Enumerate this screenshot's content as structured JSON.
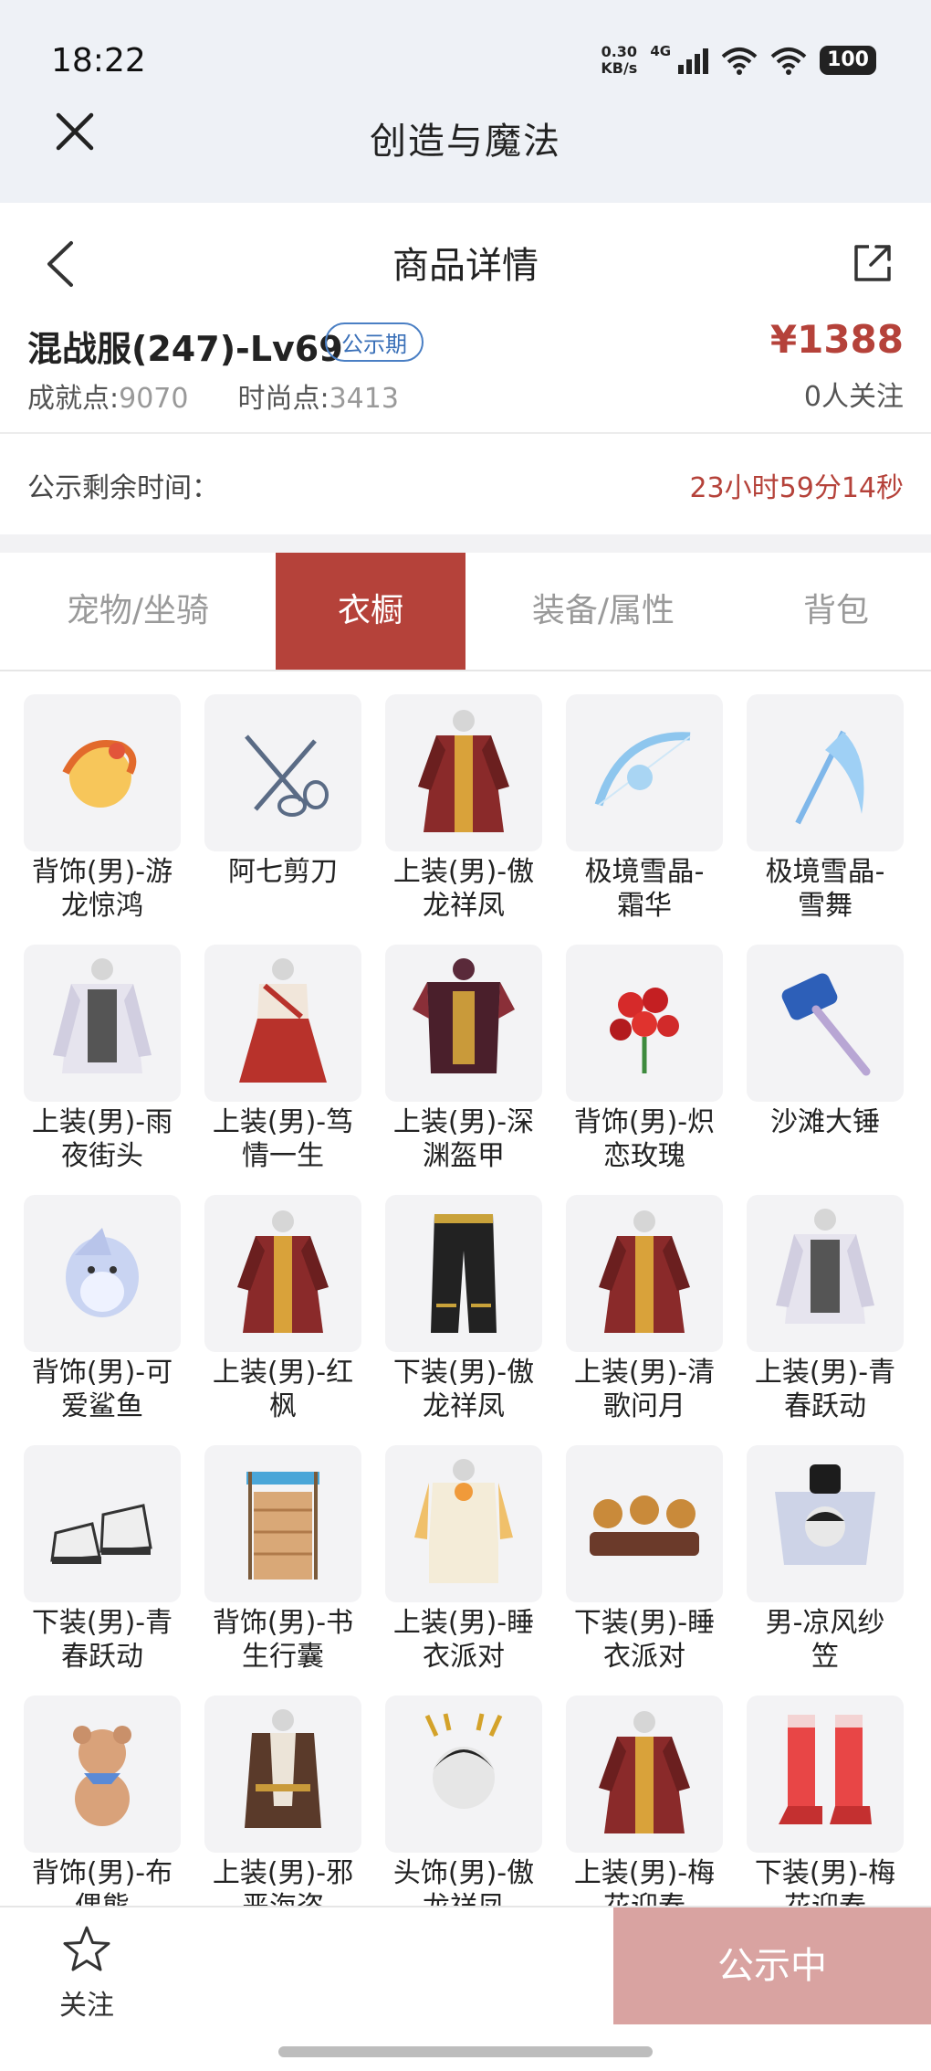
{
  "status_bar": {
    "time": "18:22",
    "speed_top": "0.30",
    "speed_bottom": "KB/s",
    "network": "4G",
    "battery": "100"
  },
  "app": {
    "title": "创造与魔法"
  },
  "nav": {
    "title": "商品详情"
  },
  "product": {
    "name": "混战服(247)-Lv69",
    "badge": "公示期",
    "price": "¥1388",
    "achievement_label": "成就点:",
    "achievement_value": "9070",
    "fashion_label": "时尚点:",
    "fashion_value": "3413",
    "followers": "0人关注"
  },
  "remaining": {
    "label": "公示剩余时间：",
    "value": "23小时59分14秒"
  },
  "tabs": [
    {
      "label": "宠物/坐骑",
      "active": false
    },
    {
      "label": "衣橱",
      "active": true
    },
    {
      "label": "装备/属性",
      "active": false
    },
    {
      "label": "背包",
      "active": false
    }
  ],
  "items": [
    {
      "line1": "背饰(男)-游",
      "line2": "龙惊鸿",
      "icon": "dragon-icon"
    },
    {
      "line1": "阿七剪刀",
      "line2": "",
      "icon": "scissors-icon"
    },
    {
      "line1": "上装(男)-傲",
      "line2": "龙祥凤",
      "icon": "robe-icon"
    },
    {
      "line1": "极境雪晶-",
      "line2": "霜华",
      "icon": "bow-icon"
    },
    {
      "line1": "极境雪晶-",
      "line2": "雪舞",
      "icon": "scythe-icon"
    },
    {
      "line1": "上装(男)-雨",
      "line2": "夜街头",
      "icon": "jacket-icon"
    },
    {
      "line1": "上装(男)-笃",
      "line2": "情一生",
      "icon": "dress-icon"
    },
    {
      "line1": "上装(男)-深",
      "line2": "渊盔甲",
      "icon": "armor-icon"
    },
    {
      "line1": "背饰(男)-炽",
      "line2": "恋玫瑰",
      "icon": "roses-icon"
    },
    {
      "line1": "沙滩大锤",
      "line2": "",
      "icon": "hammer-icon"
    },
    {
      "line1": "背饰(男)-可",
      "line2": "爱鲨鱼",
      "icon": "shark-icon"
    },
    {
      "line1": "上装(男)-红",
      "line2": "枫",
      "icon": "robe-icon"
    },
    {
      "line1": "下装(男)-傲",
      "line2": "龙祥凤",
      "icon": "pants-icon"
    },
    {
      "line1": "上装(男)-清",
      "line2": "歌问月",
      "icon": "robe-icon"
    },
    {
      "line1": "上装(男)-青",
      "line2": "春跃动",
      "icon": "jacket-icon"
    },
    {
      "line1": "下装(男)-青",
      "line2": "春跃动",
      "icon": "shoes-icon"
    },
    {
      "line1": "背饰(男)-书",
      "line2": "生行囊",
      "icon": "bookcase-icon"
    },
    {
      "line1": "上装(男)-睡",
      "line2": "衣派对",
      "icon": "pajama-icon"
    },
    {
      "line1": "下装(男)-睡",
      "line2": "衣派对",
      "icon": "slippers-icon"
    },
    {
      "line1": "男-凉风纱",
      "line2": "笠",
      "icon": "hat-icon"
    },
    {
      "line1": "背饰(男)-布",
      "line2": "偶熊",
      "icon": "teddy-bear-icon"
    },
    {
      "line1": "上装(男)-邪",
      "line2": "恶海盗",
      "icon": "coat-icon"
    },
    {
      "line1": "头饰(男)-傲",
      "line2": "龙祥凤",
      "icon": "headdress-icon"
    },
    {
      "line1": "上装(男)-梅",
      "line2": "花迎春",
      "icon": "robe-icon"
    },
    {
      "line1": "下装(男)-梅",
      "line2": "花迎春",
      "icon": "boots-icon"
    }
  ],
  "bottom": {
    "follow_label": "关注",
    "action_label": "公示中"
  },
  "colors": {
    "accent": "#b5423a",
    "badge": "#3a70b8",
    "action_disabled": "#d9a3a1"
  }
}
